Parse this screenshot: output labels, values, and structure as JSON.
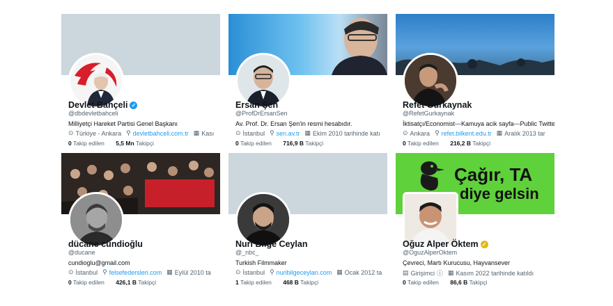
{
  "colors": {
    "link": "#1d9bf0",
    "muted": "#536471",
    "verified_blue": "#1d9bf0",
    "verified_gold": "#e2b719",
    "banner_green": "#5fd13b"
  },
  "cards": [
    {
      "name": "Devlet Bahçeli",
      "handle": "@dbdevletbahceli",
      "bio": "Milliyetçi Hareket Partisi Genel Başkanı",
      "location": "Türkiye - Ankara",
      "link": "devletbahceli.com.tr",
      "joined": "Kası",
      "following_count": "0",
      "following_label": "Takip edilen",
      "followers_count": "5,5 Mn",
      "followers_label": "Takipçi"
    },
    {
      "name": "Ersan Şen",
      "handle": "@ProfDrErsanSen",
      "bio": "Av. Prof. Dr. Ersan Şen'in resmi hesabıdır.",
      "location": "İstanbul",
      "link": "sen.av.tr",
      "joined": "Ekim 2010 tarihinde katı",
      "following_count": "0",
      "following_label": "Takip edilen",
      "followers_count": "716,9 B",
      "followers_label": "Takipçi"
    },
    {
      "name": "Refet Gürkaynak",
      "handle": "@RefetGurkaynak",
      "bio": "İktisatçı/Economist---Kamuya acik sayfa---Public Twitte",
      "location": "Ankara",
      "link": "refet.bilkent.edu.tr",
      "joined": "Aralık 2013 tar",
      "following_count": "0",
      "following_label": "Takip edilen",
      "followers_count": "216,2 B",
      "followers_label": "Takipçi"
    },
    {
      "name": "dücane cündioğlu",
      "handle": "@ducane",
      "bio": "cundioglu@gmail.com",
      "location": "İstanbul",
      "link": "felsefedersleri.com",
      "joined": "Eylül 2010 ta",
      "following_count": "0",
      "following_label": "Takip edilen",
      "followers_count": "426,1 B",
      "followers_label": "Takipçi"
    },
    {
      "name": "Nuri Bilge Ceylan",
      "handle": "@_nbc_",
      "bio": "Turkish Filmmaker",
      "location": "İstanbul",
      "link": "nuribilgeceylan.com",
      "joined": "Ocak 2012 ta",
      "following_count": "1",
      "following_label": "Takip edilen",
      "followers_count": "468 B",
      "followers_label": "Takipçi"
    },
    {
      "name": "Oğuz Alper Öktem",
      "handle": "@OguzAlperOktem",
      "bio": "Çevreci, Martı Kurucusu, Hayvansever",
      "location": "Girişimci",
      "link": "",
      "joined": "Kasım 2022 tarihinde katıldı",
      "following_count": "0",
      "following_label": "Takip edilen",
      "followers_count": "86,6 B",
      "followers_label": "Takipçi",
      "banner_text": [
        "Çağır, TA",
        "diye gelsin"
      ]
    }
  ]
}
